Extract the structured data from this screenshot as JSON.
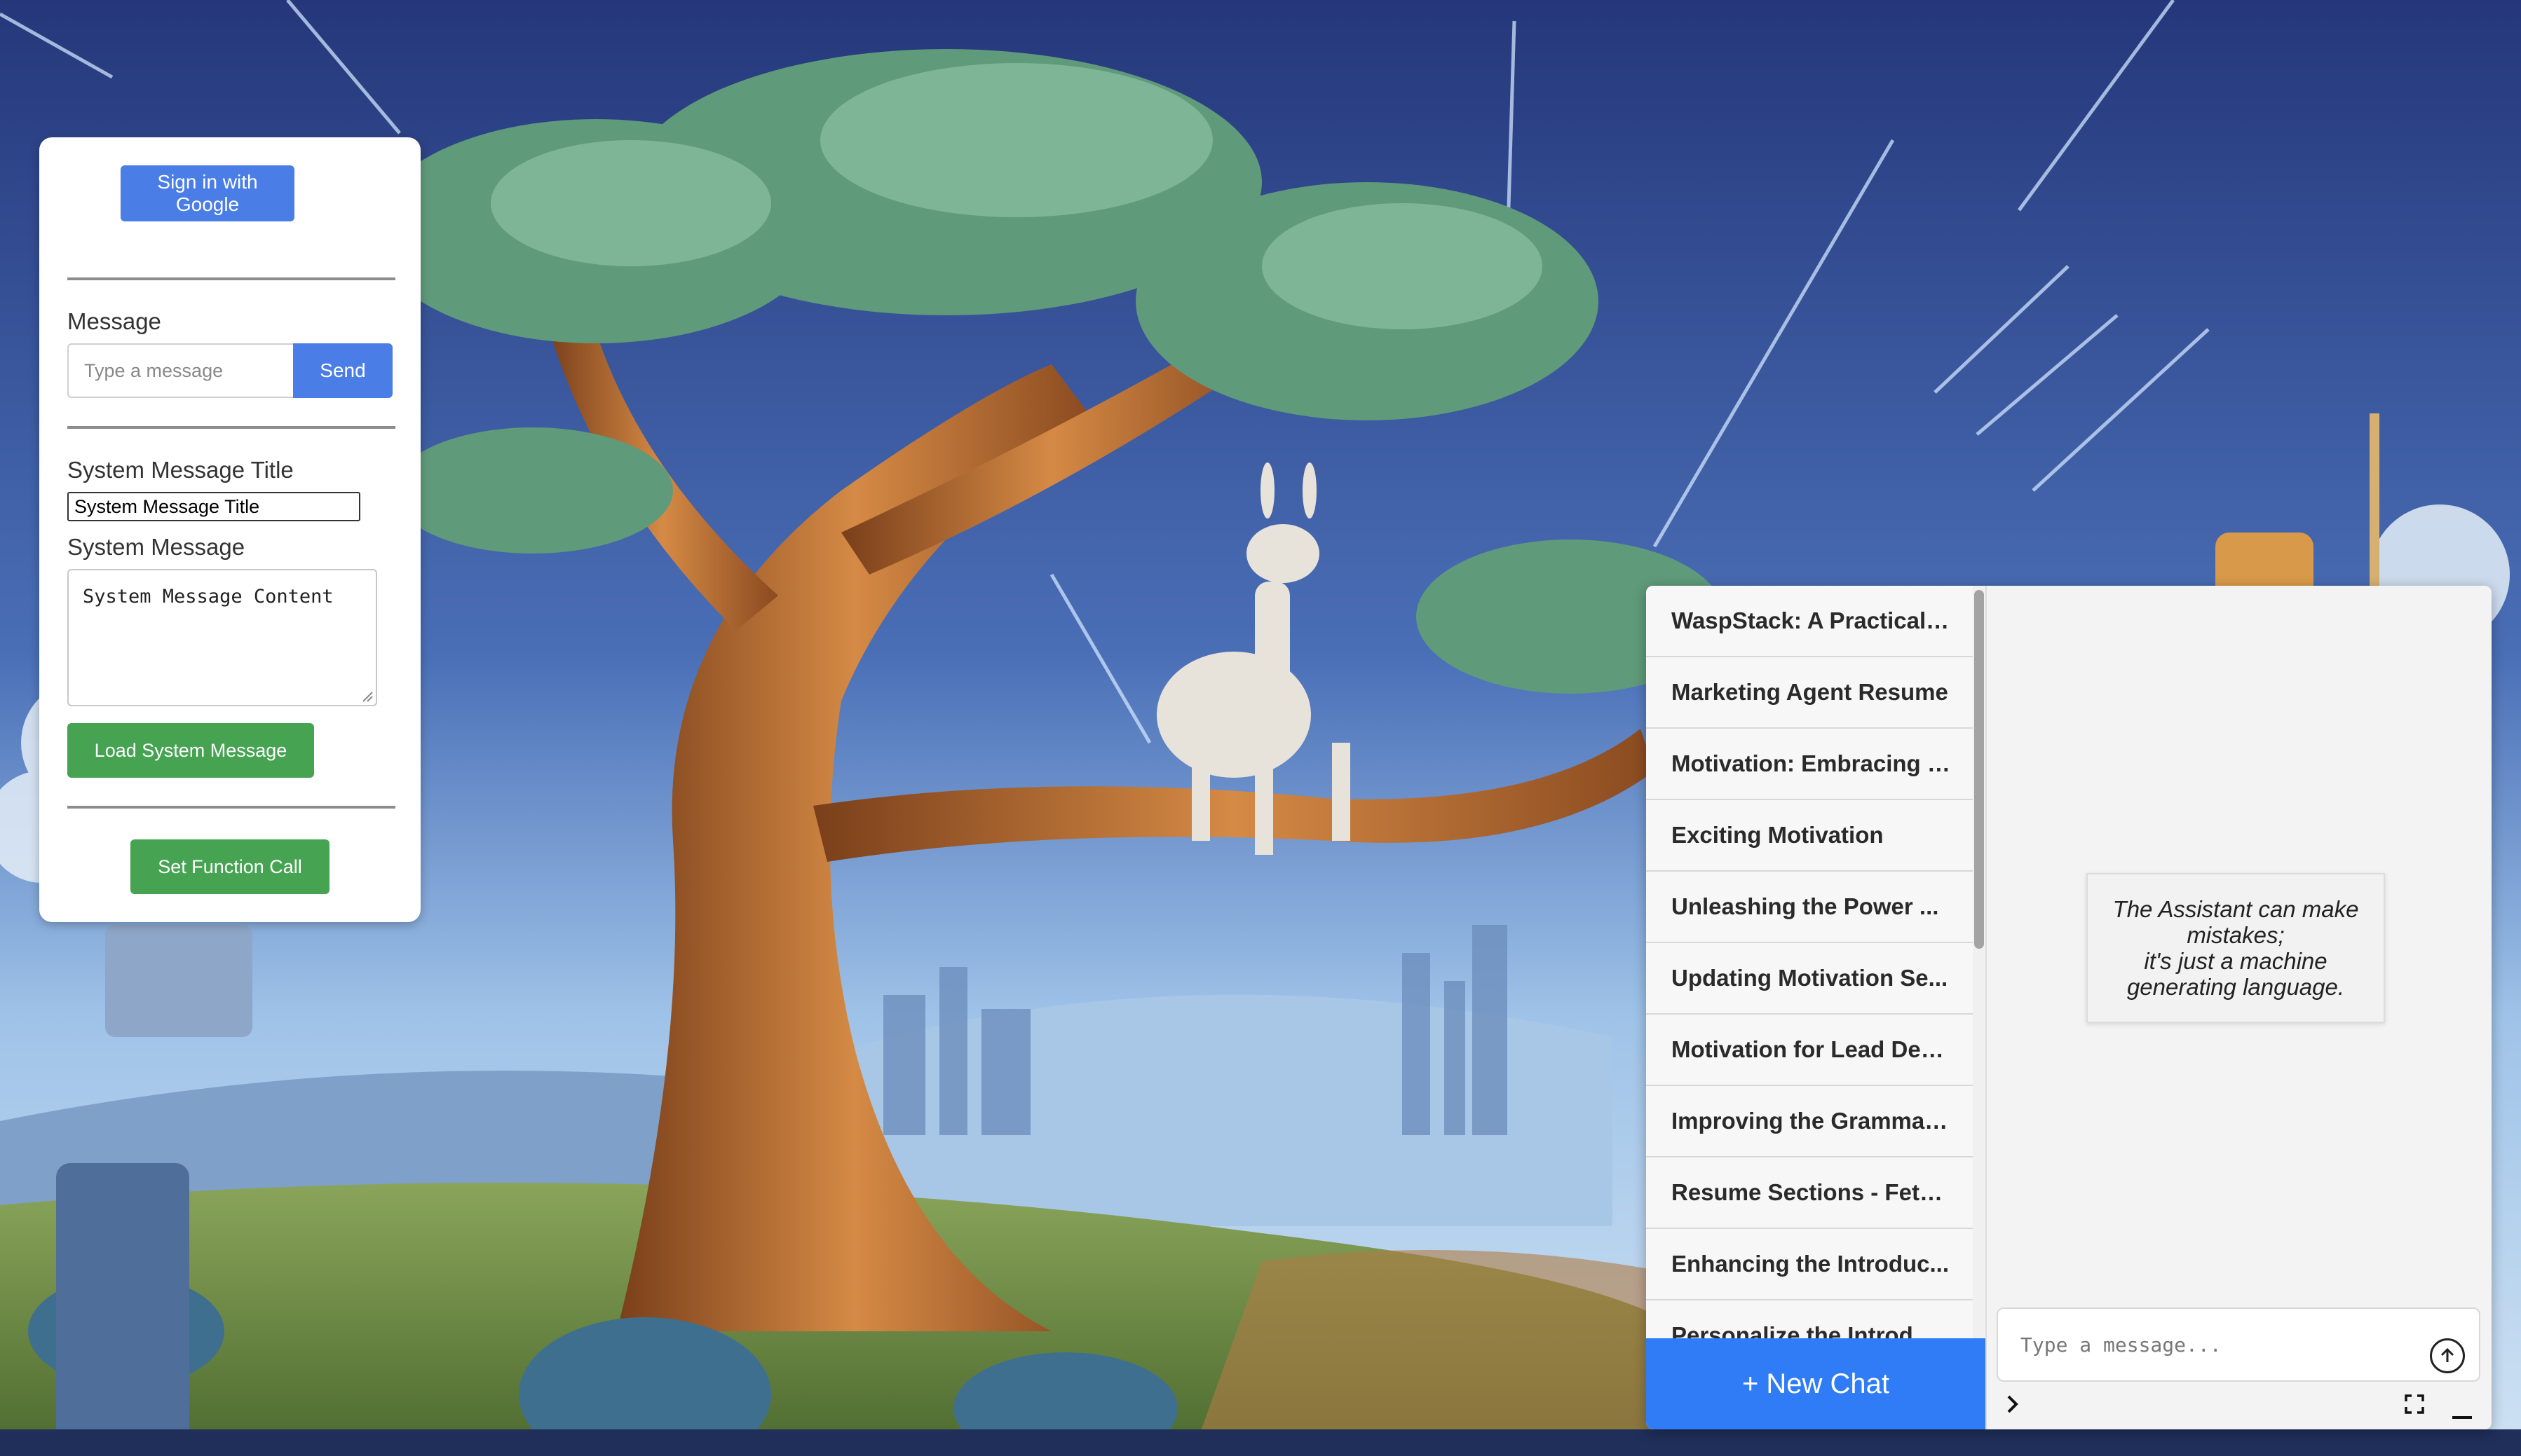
{
  "left_panel": {
    "sign_in_label": "Sign in with Google",
    "message_label": "Message",
    "message_placeholder": "Type a message",
    "send_label": "Send",
    "system_title_label": "System Message Title",
    "system_title_value": "System Message Title",
    "system_message_label": "System Message",
    "system_message_value": "System Message Content",
    "load_label": "Load System Message",
    "function_call_label": "Set Function Call"
  },
  "chat": {
    "conversations": [
      "WaspStack: A Practical ...",
      "Marketing Agent Resume",
      "Motivation: Embracing t...",
      "Exciting Motivation",
      "Unleashing the Power ...",
      "Updating Motivation Se...",
      "Motivation for Lead Dev...",
      "Improving the Grammar...",
      "Resume Sections - Fetc...",
      "Enhancing the Introduc...",
      "Personalize the Introd..."
    ],
    "new_chat_label": "+ New Chat",
    "disclaimer_line1": "The Assistant can make",
    "disclaimer_line2": "mistakes;",
    "disclaimer_line3": "it's just a machine",
    "disclaimer_line4": "generating language.",
    "input_placeholder": "Type a message..."
  },
  "icons": {
    "send": "arrow-up-circle-icon",
    "expand": "chevron-right-icon",
    "fullscreen": "fullscreen-icon",
    "minimize": "minimize-icon"
  },
  "colors": {
    "primary_blue": "#4a7de6",
    "new_chat_blue": "#2f7cf6",
    "green": "#46a352"
  }
}
